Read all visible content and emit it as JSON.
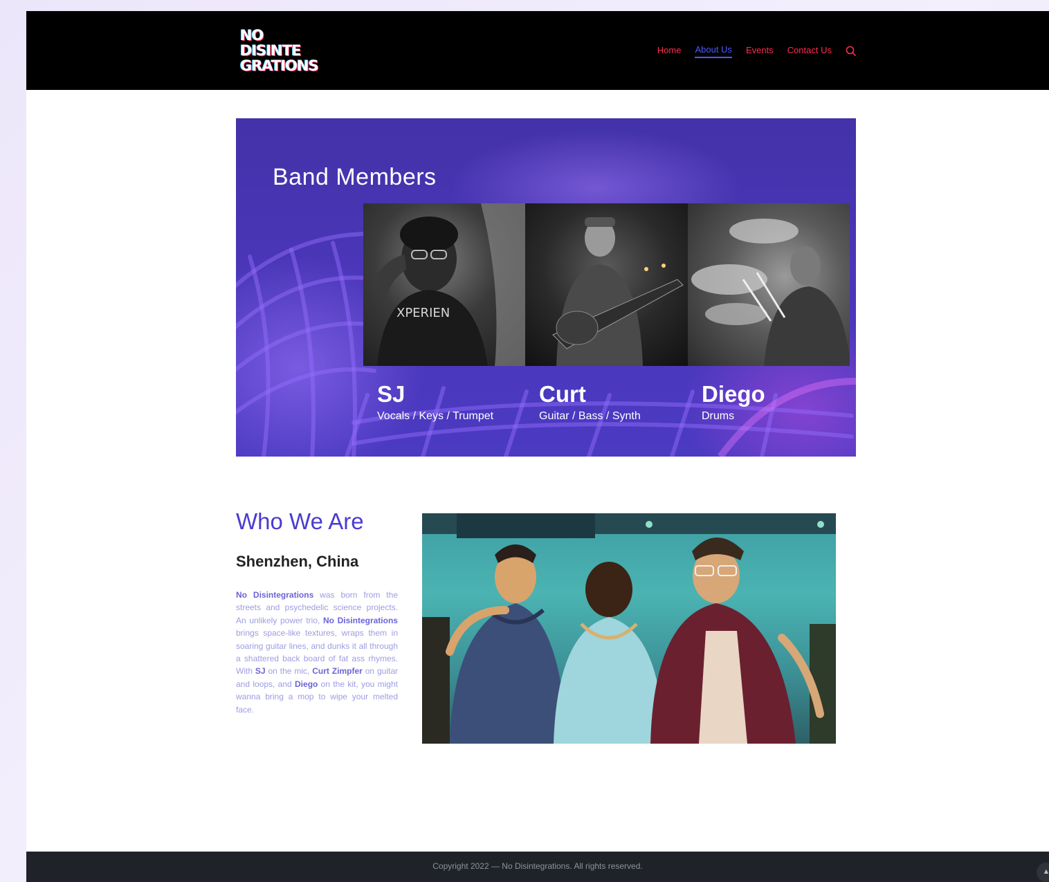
{
  "header": {
    "logo_lines": [
      "NO",
      "DISINTE",
      "GRATIONS"
    ],
    "nav": [
      {
        "label": "Home",
        "active": false
      },
      {
        "label": "About Us",
        "active": true
      },
      {
        "label": "Events",
        "active": false
      },
      {
        "label": "Contact Us",
        "active": false
      }
    ],
    "search_icon": "search-icon"
  },
  "banner": {
    "title": "Band Members",
    "photo_text": "XPERIEN",
    "members": [
      {
        "name": "SJ",
        "role": "Vocals / Keys / Trumpet"
      },
      {
        "name": "Curt",
        "role": "Guitar / Bass / Synth"
      },
      {
        "name": "Diego",
        "role": "Drums"
      }
    ]
  },
  "about": {
    "title": "Who We Are",
    "location": "Shenzhen, China",
    "bio": [
      {
        "text": "No Disintegrations",
        "bold": true
      },
      {
        "text": " was born from the streets and psychedelic science projects. An unlikely power trio, ",
        "bold": false
      },
      {
        "text": "No Disintegrations",
        "bold": true
      },
      {
        "text": " brings space-like textures, wraps them in soaring guitar lines, and dunks it all through a shattered back board of fat ass rhymes. With ",
        "bold": false
      },
      {
        "text": "SJ",
        "bold": true
      },
      {
        "text": " on the mic, ",
        "bold": false
      },
      {
        "text": "Curt Zimpfer",
        "bold": true
      },
      {
        "text": " on guitar and loops, and ",
        "bold": false
      },
      {
        "text": "Diego",
        "bold": true
      },
      {
        "text": " on the kit, you might wanna bring a mop to wipe your melted face.",
        "bold": false
      }
    ]
  },
  "footer": {
    "copyright": "Copyright 2022 — No Disintegrations. All rights reserved."
  },
  "colors": {
    "nav": "#ff2e4d",
    "nav_active": "#4a5bff",
    "accent_purple": "#4a3ccf",
    "banner_bg": "#4635b3"
  }
}
